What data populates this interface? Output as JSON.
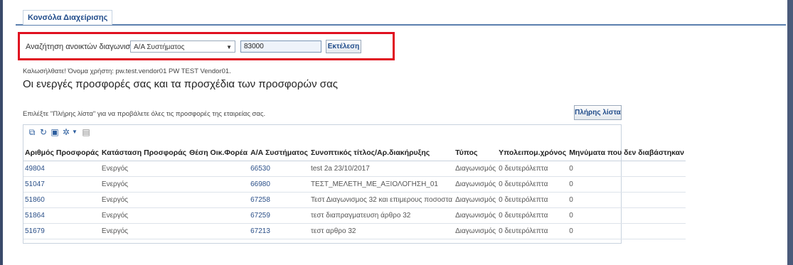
{
  "tabs": [
    {
      "label": "Κονσόλα Διαχείρισης"
    }
  ],
  "search": {
    "label": "Αναζήτηση ανοικτών διαγωνισμών",
    "select_value": "Α/Α Συστήματος",
    "input_value": "83000",
    "execute_label": "Εκτέλεση"
  },
  "welcome": "Καλωσήλθατε! Όνομα χρήστη: pw.test.vendor01 PW TEST Vendor01.",
  "heading": "Οι ενεργές προσφορές σας και τα προσχέδια των προσφορών σας",
  "hint": "Επιλέξτε \"Πλήρης λίστα\" για να προβάλετε όλες τις προσφορές της εταιρείας σας.",
  "full_list_label": "Πλήρης λίστα",
  "table": {
    "columns": [
      "Αριθμός Προσφοράς",
      "Κατάσταση Προσφοράς",
      "Θέση Οικ.Φορέα",
      "Α/Α Συστήματος",
      "Συνοπτικός τίτλος/Αρ.διακήρυξης",
      "Τύπος",
      "Υπολειπομ.χρόνος",
      "Μηνύματα που δεν διαβάστηκαν"
    ],
    "rows": [
      [
        "49804",
        "Ενεργός",
        "",
        "66530",
        "test 2a 23/10/2017",
        "Διαγωνισμός",
        "0 δευτερόλεπτα",
        "0"
      ],
      [
        "51047",
        "Ενεργός",
        "",
        "66980",
        "ΤΕΣΤ_ΜΕΛΕΤΗ_ΜΕ_ΑΞΙΟΛΟΓΗΣΗ_01",
        "Διαγωνισμός",
        "0 δευτερόλεπτα",
        "0"
      ],
      [
        "51860",
        "Ενεργός",
        "",
        "67258",
        "Τεστ Διαγωνισμος 32 και επιμερους ποσοστα",
        "Διαγωνισμός",
        "0 δευτερόλεπτα",
        "0"
      ],
      [
        "51864",
        "Ενεργός",
        "",
        "67259",
        "τεστ διαπραγματευση άρθρο 32",
        "Διαγωνισμός",
        "0 δευτερόλεπτα",
        "0"
      ],
      [
        "51679",
        "Ενεργός",
        "",
        "67213",
        "τεστ αρθρο 32",
        "Διαγωνισμός",
        "0 δευτερόλεπτα",
        "0"
      ]
    ]
  },
  "toolbar_icons": [
    "detach-icon",
    "refresh-icon",
    "export-icon",
    "settings-icon",
    "dropdown-icon",
    "columns-icon"
  ],
  "colors": {
    "accent": "#1f4b8a",
    "highlight_box": "#e01020"
  }
}
